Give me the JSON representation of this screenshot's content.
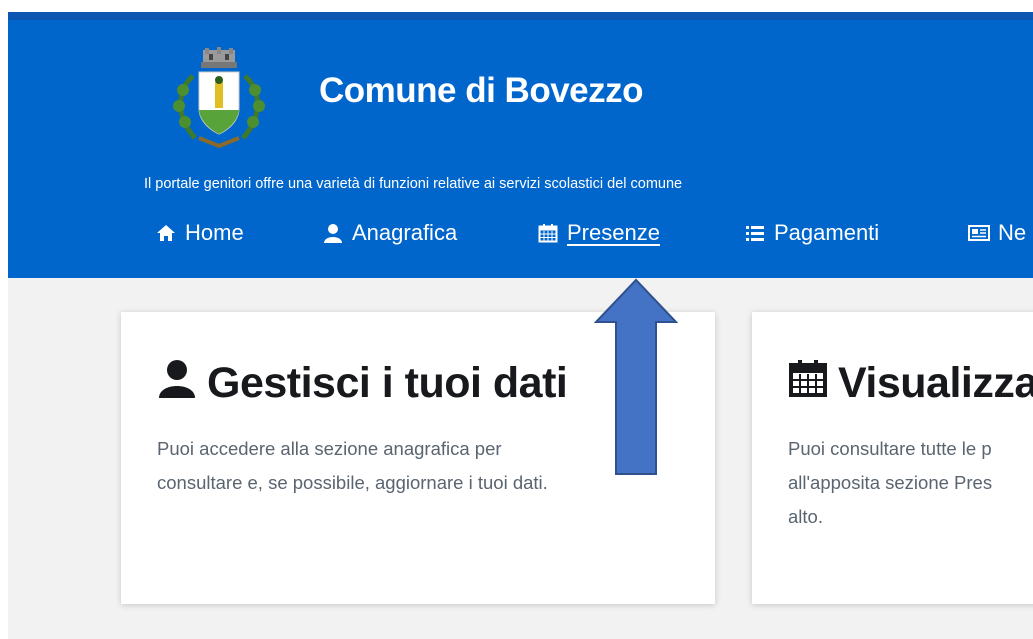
{
  "header": {
    "title": "Comune di Bovezzo",
    "tagline": "Il portale genitori offre una varietà di funzioni relative ai servizi scolastici del comune",
    "crest_icon": "coat-of-arms-logo",
    "background_color": "#0066cc"
  },
  "nav": {
    "items": [
      {
        "label": "Home",
        "icon": "home-icon"
      },
      {
        "label": "Anagrafica",
        "icon": "user-icon"
      },
      {
        "label": "Presenze",
        "icon": "calendar-icon",
        "active": true
      },
      {
        "label": "Pagamenti",
        "icon": "list-icon"
      },
      {
        "label": "Ne",
        "icon": "newspaper-icon"
      }
    ]
  },
  "cards": [
    {
      "title": "Gestisci i tuoi dati",
      "icon": "user-icon",
      "lines": [
        "Puoi accedere alla sezione anagrafica per",
        "consultare e, se possibile, aggiornare i tuoi dati."
      ]
    },
    {
      "title": "Visualizza",
      "icon": "calendar-icon",
      "lines": [
        "Puoi consultare tutte le p",
        "all'apposita sezione Pres",
        "alto."
      ]
    }
  ],
  "annotation": {
    "arrow_color": "#4472c4",
    "arrow_direction": "up"
  }
}
